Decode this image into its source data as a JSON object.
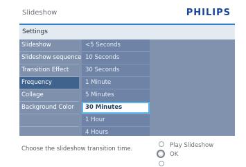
{
  "header": {
    "title": "Slideshow",
    "brand": "PHILIPS"
  },
  "breadcrumb": {
    "label": "Settings"
  },
  "menu": {
    "items": [
      {
        "label": "Slideshow",
        "active": false
      },
      {
        "label": "Slideshow sequence",
        "active": false
      },
      {
        "label": "Transition Effect",
        "active": false
      },
      {
        "label": "Frequency",
        "active": true
      },
      {
        "label": "Collage",
        "active": false
      },
      {
        "label": "Background Color",
        "active": false
      }
    ]
  },
  "submenu": {
    "options": [
      {
        "label": "<5 Seconds",
        "selected": false
      },
      {
        "label": "10 Seconds",
        "selected": false
      },
      {
        "label": "30 Seconds",
        "selected": false
      },
      {
        "label": "1 Minute",
        "selected": false
      },
      {
        "label": "5 Minutes",
        "selected": false
      },
      {
        "label": "30 Minutes",
        "selected": true
      },
      {
        "label": "1 Hour",
        "selected": false
      },
      {
        "label": "4 Hours",
        "selected": false
      }
    ]
  },
  "footer": {
    "description": "Choose the slideshow transition time.",
    "play_label": "Play Slideshow",
    "ok_label": "OK"
  },
  "colors": {
    "brand": "#17459a",
    "accent_rule": "#2f7fd0",
    "menu_bg": "#7e90ab",
    "menu_active": "#3f638c",
    "submenu_bg": "#6e83a5",
    "selection_border": "#5ab6ee"
  }
}
